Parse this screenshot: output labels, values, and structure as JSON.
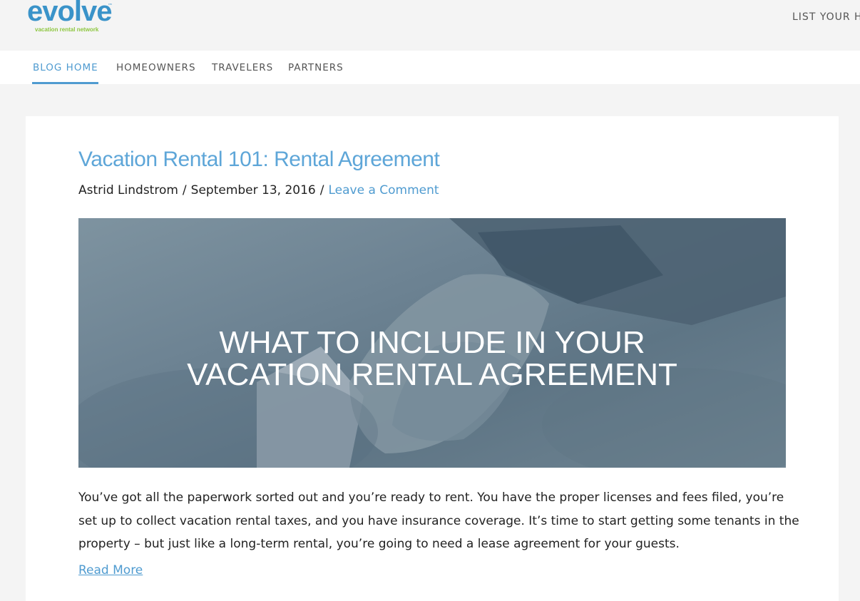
{
  "header": {
    "logo_text": "evolve",
    "logo_tm": "™",
    "logo_tagline": "vacation rental network",
    "list_link": "LIST YOUR HO"
  },
  "nav": {
    "items": [
      {
        "label": "BLOG HOME",
        "active": true
      },
      {
        "label": "HOMEOWNERS",
        "active": false
      },
      {
        "label": "TRAVELERS",
        "active": false
      },
      {
        "label": "PARTNERS",
        "active": false
      }
    ]
  },
  "post": {
    "title": "Vacation Rental 101: Rental Agreement",
    "author": "Astrid Lindstrom",
    "separator": "/",
    "date": "September 13, 2016",
    "comment_link": "Leave a Comment",
    "hero": {
      "line1": "WHAT TO INCLUDE IN YOUR",
      "line2": "VACATION RENTAL AGREEMENT"
    },
    "excerpt_lines": [
      "You’ve got all the paperwork sorted out and you’re ready to rent. You have the proper licenses and fees filed, you’re",
      "set up to collect vacation rental taxes, and you have insurance coverage. It’s time to start getting some tenants in the",
      "property – but just like a long-term rental, you’re going to need a lease agreement for your guests."
    ],
    "read_more": "Read More"
  },
  "colors": {
    "accent": "#4f9bd0",
    "title": "#5ea6d8",
    "logo_green": "#8dc63f",
    "page_bg": "#f4f4f4"
  }
}
